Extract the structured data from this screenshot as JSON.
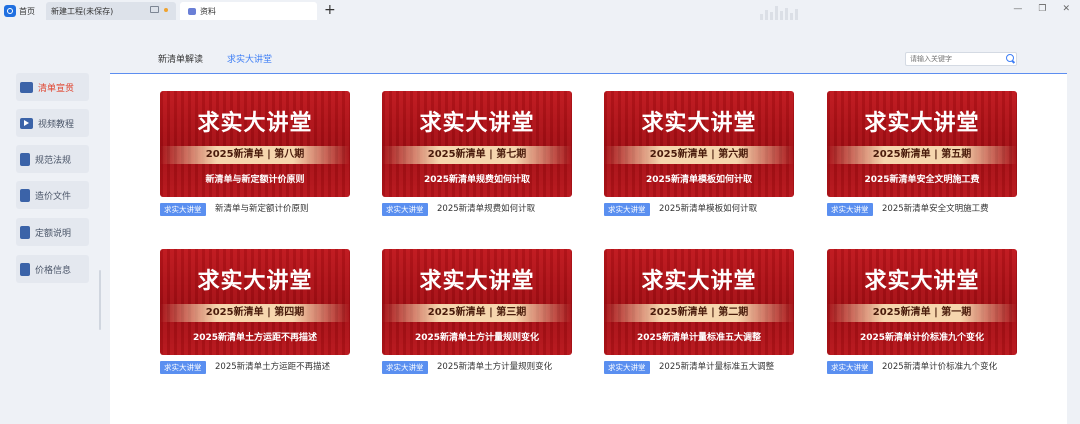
{
  "tabs": {
    "home": "首页",
    "project": "新建工程(未保存)",
    "active": "资料",
    "new_tab": "+"
  },
  "window_controls": [
    "—",
    "❐",
    "✕"
  ],
  "sidebar": {
    "items": [
      {
        "label": "清单宣贯",
        "icon": "folder-icon",
        "active": true
      },
      {
        "label": "视频教程",
        "icon": "play-icon",
        "active": false
      },
      {
        "label": "规范法规",
        "icon": "book-icon",
        "active": false
      },
      {
        "label": "造价文件",
        "icon": "file-icon",
        "active": false
      },
      {
        "label": "定额说明",
        "icon": "settings-doc-icon",
        "active": false
      },
      {
        "label": "价格信息",
        "icon": "price-doc-icon",
        "active": false
      }
    ]
  },
  "header": {
    "tabs": [
      {
        "label": "新清单解读",
        "active": false
      },
      {
        "label": "求实大讲堂",
        "active": true
      }
    ],
    "search_placeholder": "请输入关键字"
  },
  "cards": [
    {
      "title": "求实大讲堂",
      "issue": "2025新清单 | 第八期",
      "subtitle": "新清单与新定额计价原则",
      "tag": "求实大讲堂",
      "caption": "新清单与新定额计价原则"
    },
    {
      "title": "求实大讲堂",
      "issue": "2025新清单 | 第七期",
      "subtitle": "2025新清单规费如何计取",
      "tag": "求实大讲堂",
      "caption": "2025新清单规费如何计取"
    },
    {
      "title": "求实大讲堂",
      "issue": "2025新清单 | 第六期",
      "subtitle": "2025新清单模板如何计取",
      "tag": "求实大讲堂",
      "caption": "2025新清单模板如何计取"
    },
    {
      "title": "求实大讲堂",
      "issue": "2025新清单 | 第五期",
      "subtitle": "2025新清单安全文明施工费",
      "tag": "求实大讲堂",
      "caption": "2025新清单安全文明施工费"
    },
    {
      "title": "求实大讲堂",
      "issue": "2025新清单 | 第四期",
      "subtitle": "2025新清单土方运距不再描述",
      "tag": "求实大讲堂",
      "caption": "2025新清单土方运距不再描述"
    },
    {
      "title": "求实大讲堂",
      "issue": "2025新清单 | 第三期",
      "subtitle": "2025新清单土方计量规则变化",
      "tag": "求实大讲堂",
      "caption": "2025新清单土方计量规则变化"
    },
    {
      "title": "求实大讲堂",
      "issue": "2025新清单 | 第二期",
      "subtitle": "2025新清单计量标准五大调整",
      "tag": "求实大讲堂",
      "caption": "2025新清单计量标准五大调整"
    },
    {
      "title": "求实大讲堂",
      "issue": "2025新清单 | 第一期",
      "subtitle": "2025新清单计价标准九个变化",
      "tag": "求实大讲堂",
      "caption": "2025新清单计价标准九个变化"
    }
  ]
}
